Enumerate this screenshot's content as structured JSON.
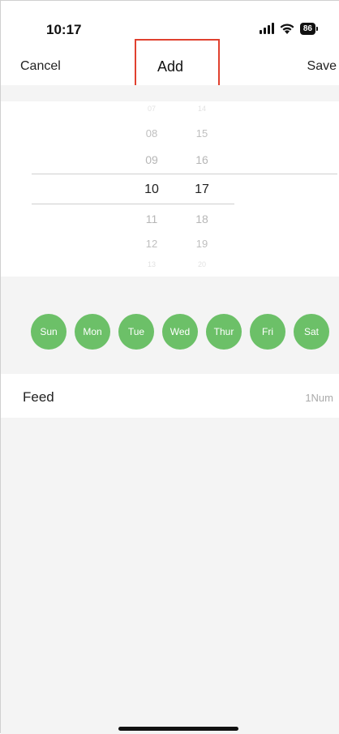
{
  "status_bar": {
    "time": "10:17",
    "battery": "86"
  },
  "nav": {
    "cancel_label": "Cancel",
    "title": "Add",
    "save_label": "Save"
  },
  "picker": {
    "hours": [
      "07",
      "08",
      "09",
      "10",
      "11",
      "12",
      "13"
    ],
    "minutes": [
      "14",
      "15",
      "16",
      "17",
      "18",
      "19",
      "20"
    ],
    "selected_hour": "10",
    "selected_minute": "17"
  },
  "days": [
    {
      "label": "Sun"
    },
    {
      "label": "Mon"
    },
    {
      "label": "Tue"
    },
    {
      "label": "Wed"
    },
    {
      "label": "Thur"
    },
    {
      "label": "Fri"
    },
    {
      "label": "Sat"
    }
  ],
  "feed": {
    "label": "Feed",
    "value": "1Num"
  },
  "colors": {
    "day_button": "#6cc068",
    "highlight": "#e0412f",
    "band": "#f4f4f4"
  },
  "icons": {
    "signal": "signal-icon",
    "wifi": "wifi-icon",
    "battery": "battery-icon"
  }
}
